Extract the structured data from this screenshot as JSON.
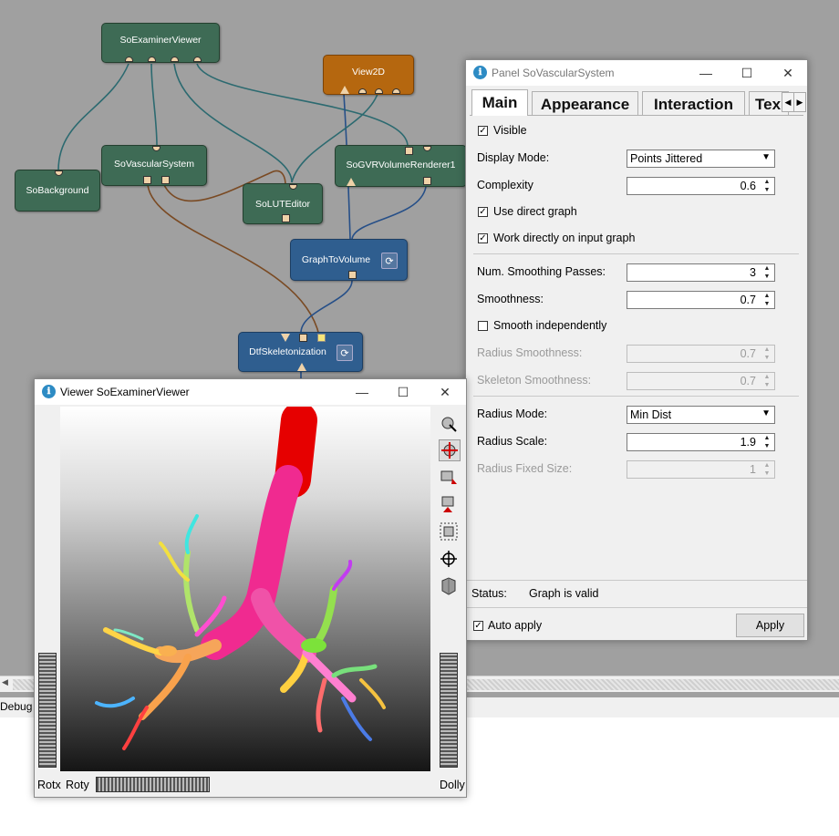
{
  "network": {
    "modules": {
      "so_examiner_viewer": "SoExaminerViewer",
      "view2d": "View2D",
      "so_background": "SoBackground",
      "so_vascular_system": "SoVascularSystem",
      "so_lut_editor": "SoLUTEditor",
      "so_gvr_volume_renderer": "SoGVRVolumeRenderer1",
      "graph_to_volume": "GraphToVolume",
      "dtf_skeletonization": "DtfSkeletonization"
    }
  },
  "console": {
    "debug_tab": "Debug"
  },
  "panel": {
    "title": "Panel SoVascularSystem",
    "tabs": [
      "Main",
      "Appearance",
      "Interaction",
      "Tex"
    ],
    "visible_label": "Visible",
    "visible_checked": true,
    "display_mode_label": "Display Mode:",
    "display_mode_value": "Points Jittered",
    "complexity_label": "Complexity",
    "complexity_value": "0.6",
    "use_direct_graph_label": "Use direct graph",
    "work_directly_label": "Work directly on input graph",
    "num_smoothing_label": "Num. Smoothing Passes:",
    "num_smoothing_value": "3",
    "smoothness_label": "Smoothness:",
    "smoothness_value": "0.7",
    "smooth_independently_label": "Smooth independently",
    "radius_smoothness_label": "Radius Smoothness:",
    "radius_smoothness_value": "0.7",
    "skeleton_smoothness_label": "Skeleton Smoothness:",
    "skeleton_smoothness_value": "0.7",
    "radius_mode_label": "Radius Mode:",
    "radius_mode_value": "Min Dist",
    "radius_scale_label": "Radius Scale:",
    "radius_scale_value": "1.9",
    "radius_fixed_label": "Radius Fixed Size:",
    "radius_fixed_value": "1",
    "status_label": "Status:",
    "status_value": "Graph is valid",
    "auto_apply_label": "Auto apply",
    "apply_button": "Apply"
  },
  "viewer": {
    "title": "Viewer SoExaminerViewer",
    "rotx_label": "Rotx",
    "roty_label": "Roty",
    "dolly_label": "Dolly"
  },
  "colors": {
    "module_green": "#3e6b55",
    "module_blue": "#2f5e8f",
    "module_orange": "#b5670f",
    "wire_teal": "#2c6a70",
    "wire_blue": "#264f88",
    "wire_brown": "#7a4a23"
  }
}
